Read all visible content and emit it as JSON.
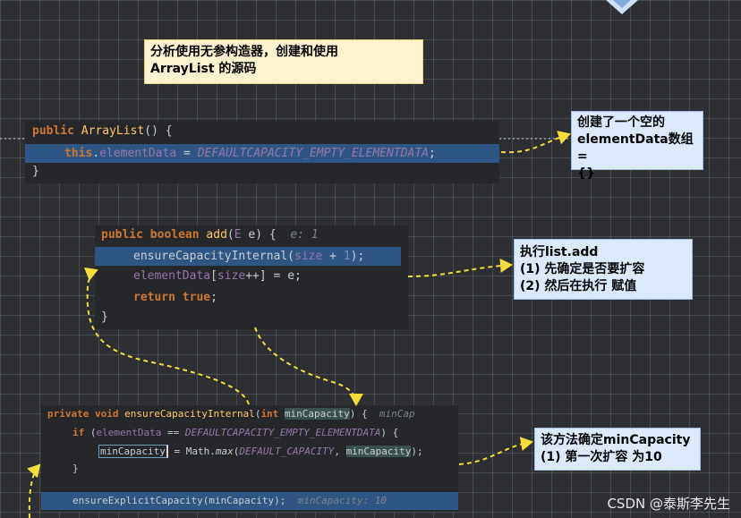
{
  "title_note": {
    "line1": "分析使用无参构造器，创建和使用",
    "line2": "ArrayList 的源码"
  },
  "constructor_block": {
    "l1_kw": "public",
    "l1_name": "ArrayList",
    "l1_rest": "() {",
    "l2_this": "this",
    "l2_dot": ".",
    "l2_field": "elementData",
    "l2_eq": " = ",
    "l2_const": "DEFAULTCAPACITY_EMPTY_ELEMENTDATA",
    "l2_semi": ";",
    "l3": "}"
  },
  "note_constructor": {
    "line1": "创建了一个空的",
    "line2": "elementData数组=",
    "line3": "{}"
  },
  "add_block": {
    "l1_kw1": "public",
    "l1_kw2": "boolean",
    "l1_name": "add",
    "l1_paren": "(",
    "l1_type": "E",
    "l1_rest": " e) {",
    "l1_hint": "e: 1",
    "l2_call": "ensureCapacityInternal(",
    "l2_size": "size",
    "l2_plus": " + ",
    "l2_num": "1",
    "l2_end": ");",
    "l3_field": "elementData",
    "l3_br": "[",
    "l3_size": "size",
    "l3_rest": "++] = e;",
    "l4_kw1": "return",
    "l4_kw2": "true",
    "l4_semi": ";",
    "l5": "}"
  },
  "note_add": {
    "line1": "执行list.add",
    "line2": "(1) 先确定是否要扩容",
    "line3": "(2) 然后在执行 赋值"
  },
  "ensure_block": {
    "l1_kw1": "private",
    "l1_kw2": "void",
    "l1_name": "ensureCapacityInternal",
    "l1_paren": "(",
    "l1_kw3": "int",
    "l1_param": "minCapacity",
    "l1_rest": ") {",
    "l1_hint": "minCap",
    "l2_kw": "if",
    "l2_open": " (",
    "l2_field": "elementData",
    "l2_eq": " == ",
    "l2_const": "DEFAULTCAPACITY_EMPTY_ELEMENTDATA",
    "l2_close": ") {",
    "l3_param": "minCapacity",
    "l3_eq": " = Math.",
    "l3_max": "max",
    "l3_paren": "(",
    "l3_const": "DEFAULT_CAPACITY",
    "l3_comma": ", ",
    "l3_param2": "minCapacity",
    "l3_end": ");",
    "l4": "}",
    "l5_call": "ensureExplicitCapacity(minCapacity);",
    "l5_hint": "minCapacity: 10"
  },
  "note_ensure": {
    "line1": "该方法确定minCapacity",
    "line2": "(1) 第一次扩容 为10"
  },
  "watermark": "CSDN @泰斯李先生",
  "colors": {
    "arrow": "#f5dd3a",
    "note_yellow": "#fdf3cf",
    "note_blue": "#dbe9fb",
    "selection": "#2f5584"
  }
}
